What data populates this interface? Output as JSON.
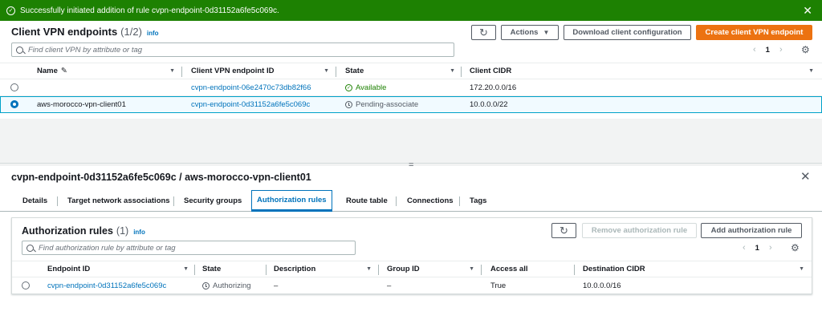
{
  "flash": {
    "message": "Successfully initiated addition of rule cvpn-endpoint-0d31152a6fe5c069c.",
    "close": "✕"
  },
  "endpoints": {
    "title": "Client VPN endpoints",
    "count": "(1/2)",
    "info": "info",
    "actions_label": "Actions",
    "download_label": "Download client configuration",
    "create_label": "Create client VPN endpoint",
    "search_placeholder": "Find client VPN by attribute or tag",
    "page": "1",
    "columns": [
      "Name",
      "Client VPN endpoint ID",
      "State",
      "Client CIDR"
    ],
    "rows": [
      {
        "name": "",
        "id": "cvpn-endpoint-06e2470c73db82f66",
        "state": "Available",
        "cidr": "172.20.0.0/16",
        "selected": false
      },
      {
        "name": "aws-morocco-vpn-client01",
        "id": "cvpn-endpoint-0d31152a6fe5c069c",
        "state": "Pending-associate",
        "cidr": "10.0.0.0/22",
        "selected": true
      }
    ]
  },
  "details": {
    "title": "cvpn-endpoint-0d31152a6fe5c069c / aws-morocco-vpn-client01",
    "tabs": [
      "Details",
      "Target network associations",
      "Security groups",
      "Authorization rules",
      "Route table",
      "Connections",
      "Tags"
    ],
    "active_tab": "Authorization rules"
  },
  "auth_rules": {
    "title": "Authorization rules",
    "count": "(1)",
    "info": "info",
    "remove_label": "Remove authorization rule",
    "add_label": "Add authorization rule",
    "search_placeholder": "Find authorization rule by attribute or tag",
    "page": "1",
    "columns": [
      "Endpoint ID",
      "State",
      "Description",
      "Group ID",
      "Access all",
      "Destination CIDR"
    ],
    "rows": [
      {
        "endpoint_id": "cvpn-endpoint-0d31152a6fe5c069c",
        "state": "Authorizing",
        "description": "–",
        "group_id": "–",
        "access_all": "True",
        "destination_cidr": "10.0.0.0/16"
      }
    ]
  },
  "colors": {
    "success": "#1d8102",
    "primary": "#ec7211",
    "link": "#0073bb"
  }
}
